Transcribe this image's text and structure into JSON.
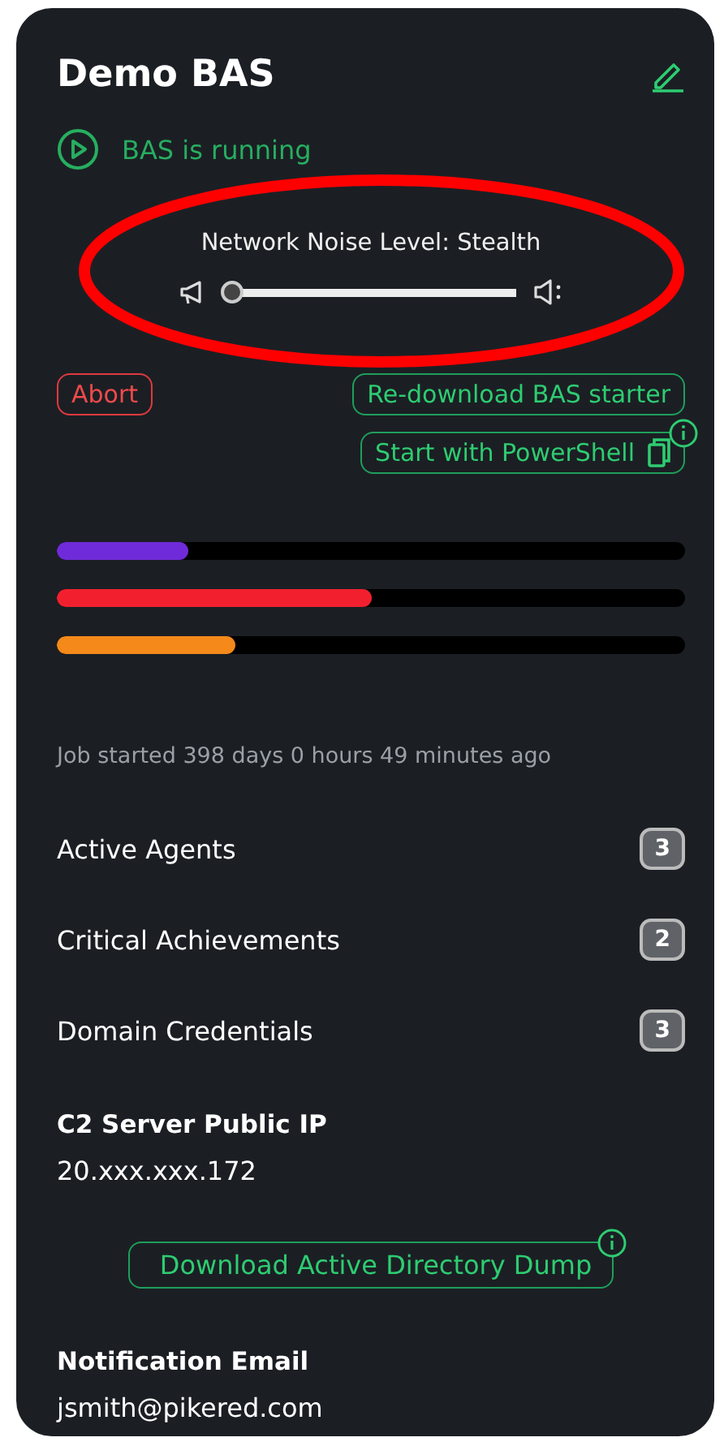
{
  "title": "Demo BAS",
  "status": {
    "text": "BAS is running"
  },
  "noise": {
    "label": "Network Noise Level: Stealth",
    "level": 0
  },
  "actions": {
    "abort": "Abort",
    "redownload": "Re-download BAS starter",
    "powershell": "Start with PowerShell"
  },
  "progress_bars": [
    {
      "color": "#6f2bd9",
      "level": 0.21
    },
    {
      "color": "#f2202f",
      "level": 0.5
    },
    {
      "color": "#f5891a",
      "level": 0.285
    }
  ],
  "job_started": "Job started 398 days 0 hours 49 minutes ago",
  "counters": [
    {
      "label": "Active Agents",
      "count": "3"
    },
    {
      "label": "Critical Achievements",
      "count": "2"
    },
    {
      "label": "Domain Credentials",
      "count": "3"
    }
  ],
  "c2": {
    "label": "C2 Server Public IP",
    "value": "20.xxx.xxx.172"
  },
  "download": "Download Active Directory Dump",
  "email": {
    "label": "Notification Email",
    "value": "jsmith@pikered.com"
  }
}
